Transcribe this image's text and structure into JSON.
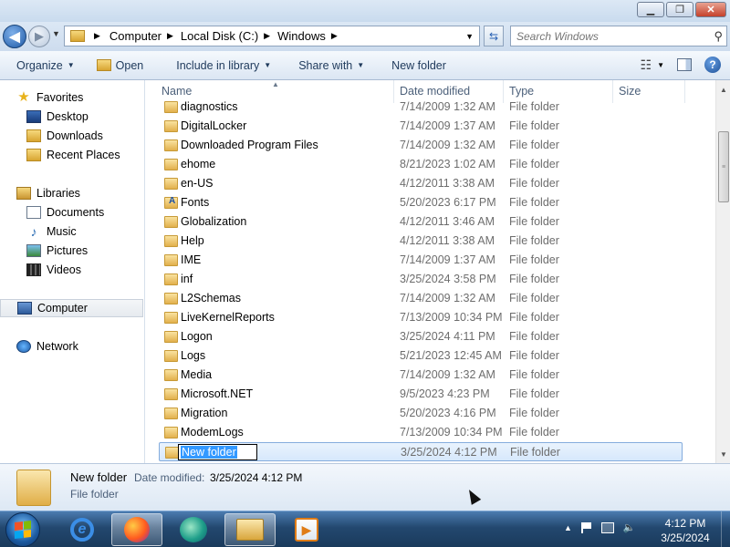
{
  "window": {
    "minimize_label": "▭",
    "maximize_label": "❐",
    "close_label": "✕"
  },
  "address": {
    "crumbs": [
      "Computer",
      "Local Disk (C:)",
      "Windows"
    ]
  },
  "search": {
    "placeholder": "Search Windows"
  },
  "toolbar": {
    "organize": "Organize",
    "open": "Open",
    "include_in_library": "Include in library",
    "share_with": "Share with",
    "new_folder": "New folder"
  },
  "nav": {
    "favorites": "Favorites",
    "desktop": "Desktop",
    "downloads": "Downloads",
    "recent_places": "Recent Places",
    "libraries": "Libraries",
    "documents": "Documents",
    "music": "Music",
    "pictures": "Pictures",
    "videos": "Videos",
    "computer": "Computer",
    "network": "Network"
  },
  "columns": {
    "name": "Name",
    "date_modified": "Date modified",
    "type": "Type",
    "size": "Size"
  },
  "files": [
    {
      "name": "diagnostics",
      "date": "7/14/2009 1:32 AM",
      "type": "File folder"
    },
    {
      "name": "DigitalLocker",
      "date": "7/14/2009 1:37 AM",
      "type": "File folder"
    },
    {
      "name": "Downloaded Program Files",
      "date": "7/14/2009 1:32 AM",
      "type": "File folder"
    },
    {
      "name": "ehome",
      "date": "8/21/2023 1:02 AM",
      "type": "File folder"
    },
    {
      "name": "en-US",
      "date": "4/12/2011 3:38 AM",
      "type": "File folder"
    },
    {
      "name": "Fonts",
      "date": "5/20/2023 6:17 PM",
      "type": "File folder"
    },
    {
      "name": "Globalization",
      "date": "4/12/2011 3:46 AM",
      "type": "File folder"
    },
    {
      "name": "Help",
      "date": "4/12/2011 3:38 AM",
      "type": "File folder"
    },
    {
      "name": "IME",
      "date": "7/14/2009 1:37 AM",
      "type": "File folder"
    },
    {
      "name": "inf",
      "date": "3/25/2024 3:58 PM",
      "type": "File folder"
    },
    {
      "name": "L2Schemas",
      "date": "7/14/2009 1:32 AM",
      "type": "File folder"
    },
    {
      "name": "LiveKernelReports",
      "date": "7/13/2009 10:34 PM",
      "type": "File folder"
    },
    {
      "name": "Logon",
      "date": "3/25/2024 4:11 PM",
      "type": "File folder"
    },
    {
      "name": "Logs",
      "date": "5/21/2023 12:45 AM",
      "type": "File folder"
    },
    {
      "name": "Media",
      "date": "7/14/2009 1:32 AM",
      "type": "File folder"
    },
    {
      "name": "Microsoft.NET",
      "date": "9/5/2023 4:23 PM",
      "type": "File folder"
    },
    {
      "name": "Migration",
      "date": "5/20/2023 4:16 PM",
      "type": "File folder"
    },
    {
      "name": "ModemLogs",
      "date": "7/13/2009 10:34 PM",
      "type": "File folder"
    },
    {
      "name": "New folder",
      "date": "3/25/2024 4:12 PM",
      "type": "File folder"
    }
  ],
  "details": {
    "name": "New folder",
    "date_label": "Date modified:",
    "date_value": "3/25/2024 4:12 PM",
    "type": "File folder"
  },
  "taskbar": {
    "time": "4:12 PM",
    "date": "3/25/2024"
  }
}
